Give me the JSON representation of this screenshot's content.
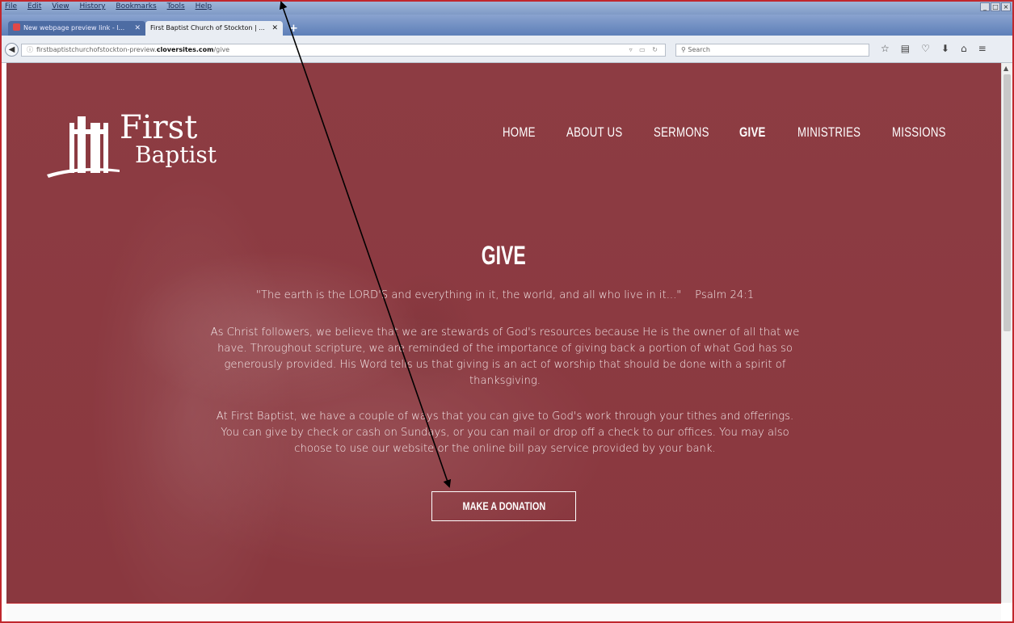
{
  "browser": {
    "menu": [
      "File",
      "Edit",
      "View",
      "History",
      "Bookmarks",
      "Tools",
      "Help"
    ],
    "tabs": [
      {
        "title": "New webpage preview link - l...",
        "active": false
      },
      {
        "title": "First Baptist Church of Stockton | ...",
        "active": true
      }
    ],
    "url_prefix": "firstbaptistchurchofstockton-preview.",
    "url_domain": "cloversites.com",
    "url_path": "/give",
    "search_placeholder": "Search"
  },
  "site": {
    "logo": {
      "line1": "First",
      "line2": "Baptist"
    },
    "nav": [
      "HOME",
      "ABOUT US",
      "SERMONS",
      "GIVE",
      "MINISTRIES",
      "MISSIONS"
    ],
    "active_nav": "GIVE",
    "title": "GIVE",
    "quote": "\"The earth is the LORD'S and everything in it, the world, and all who live in it...\"    Psalm 24:1",
    "para1": "As Christ followers, we believe that we are stewards of God's resources because He is the owner of all that we have. Throughout scripture, we are reminded of the importance of giving back a portion of what God has so generously provided. His Word tells us that giving is an act of worship that should be done with a spirit of thanksgiving.",
    "para2": "At First Baptist, we have a couple of ways that you can give to God's work through your tithes and offerings. You can give by check or cash on Sundays, or you can mail or drop off a check to our offices. You may also choose to use our website or the online bill pay service provided by your bank.",
    "donate_label": "MAKE A DONATION"
  },
  "colors": {
    "hero": "#8a383f",
    "frame_border": "#c0272d",
    "text": "#ffffff"
  }
}
